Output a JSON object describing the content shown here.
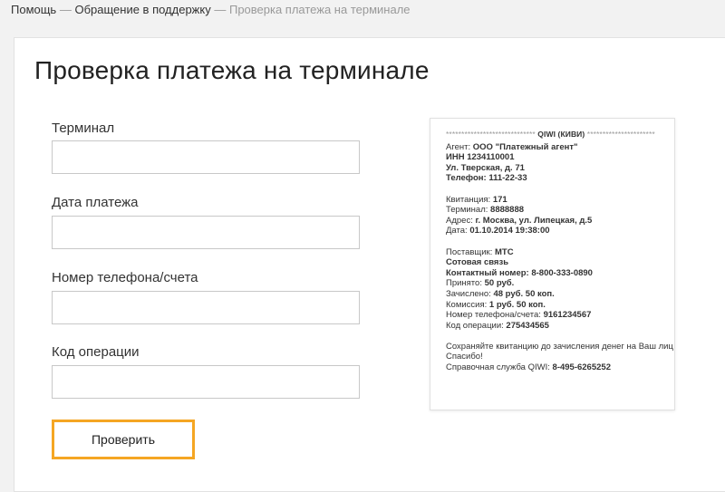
{
  "breadcrumb": {
    "items": [
      "Помощь",
      "Обращение в поддержку"
    ],
    "separator": "—",
    "current": "Проверка платежа на терминале"
  },
  "page_title": "Проверка платежа на терминале",
  "form": {
    "terminal_label": "Терминал",
    "terminal_value": "",
    "date_label": "Дата платежа",
    "date_value": "",
    "phone_label": "Номер телефона/счета",
    "phone_value": "",
    "operation_label": "Код операции",
    "operation_value": "",
    "submit_label": "Проверить"
  },
  "colors": {
    "highlight": "#f5a623",
    "background": "#f2f2f2"
  },
  "receipt": {
    "header_stars_left": "*****************************",
    "header_title": "QIWI (КИВИ)",
    "header_stars_right": "**********************",
    "agent_label": "Агент:",
    "agent_value": "ООО \"Платежный агент\"",
    "inn": "ИНН 1234110001",
    "address_line": "Ул. Тверская, д. 71",
    "phone_line": "Телефон: 111-22-33",
    "receipt_label": "Квитанция:",
    "receipt_value": "171",
    "terminal_label": "Терминал:",
    "terminal_value": "8888888",
    "address_label": "Адрес:",
    "address_value": "г. Москва, ул. Липецкая, д.5",
    "date_label": "Дата:",
    "date_value": "01.10.2014 19:38:00",
    "provider_label": "Поставщик:",
    "provider_value": "МТС",
    "service": "Сотовая связь",
    "contact_line": "Контактный номер: 8-800-333-0890",
    "accepted_label": "Принято:",
    "accepted_value": "50 руб.",
    "credited_label": "Зачислено:",
    "credited_value": "48 руб. 50 коп.",
    "commission_label": "Комиссия:",
    "commission_value": "1 руб. 50 коп.",
    "account_label": "Номер телефона/счета:",
    "account_value": "9161234567",
    "operation_label": "Код операции:",
    "operation_value": "275434565",
    "note": "Сохраняйте квитанцию до зачисления денег на Ваш лиц",
    "thanks": "Спасибо!",
    "help_label": "Справочная служба QIWI:",
    "help_value": "8-495-6265252"
  }
}
